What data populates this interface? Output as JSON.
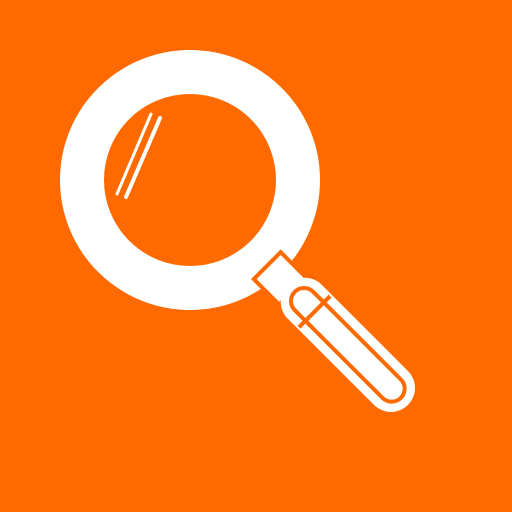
{
  "icon": {
    "name": "magnifying-glass-icon",
    "background_color": "#ff6a00",
    "foreground_color": "#ffffff"
  }
}
